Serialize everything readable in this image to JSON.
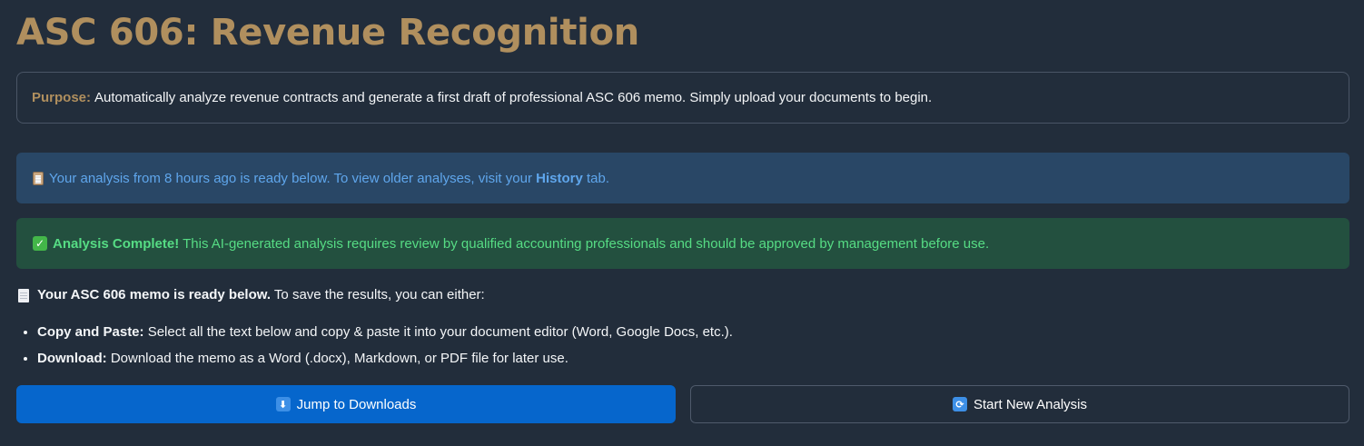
{
  "header": {
    "title": "ASC 606: Revenue Recognition"
  },
  "purpose": {
    "label": "Purpose:",
    "text": "Automatically analyze revenue contracts and generate a first draft of professional ASC 606 memo. Simply upload your documents to begin."
  },
  "info_alert": {
    "icon": "clipboard-icon",
    "text_before": "Your analysis from 8 hours ago is ready below. To view older analyses, visit your ",
    "link_text": "History",
    "text_after": " tab."
  },
  "success_alert": {
    "icon": "check-icon",
    "bold_text": "Analysis Complete!",
    "text": " This AI-generated analysis requires review by qualified accounting professionals and should be approved by management before use."
  },
  "memo": {
    "icon": "document-icon",
    "bold_text": "Your ASC 606 memo is ready below.",
    "text": " To save the results, you can either:",
    "options": [
      {
        "label": "Copy and Paste:",
        "text": " Select all the text below and copy & paste it into your document editor (Word, Google Docs, etc.)."
      },
      {
        "label": "Download:",
        "text": " Download the memo as a Word (.docx), Markdown, or PDF file for later use."
      }
    ]
  },
  "buttons": {
    "jump": {
      "icon": "down-arrow-icon",
      "glyph": "⬇",
      "label": "Jump to Downloads"
    },
    "new_analysis": {
      "icon": "refresh-icon",
      "glyph": "🔄",
      "label": "Start New Analysis"
    }
  },
  "colors": {
    "background": "#222d3b",
    "title_accent": "#b08f5e",
    "info_bg": "#294766",
    "info_text": "#5fa6ec",
    "success_bg": "#23503f",
    "success_text": "#56dc84",
    "primary_button": "#0666cc"
  }
}
